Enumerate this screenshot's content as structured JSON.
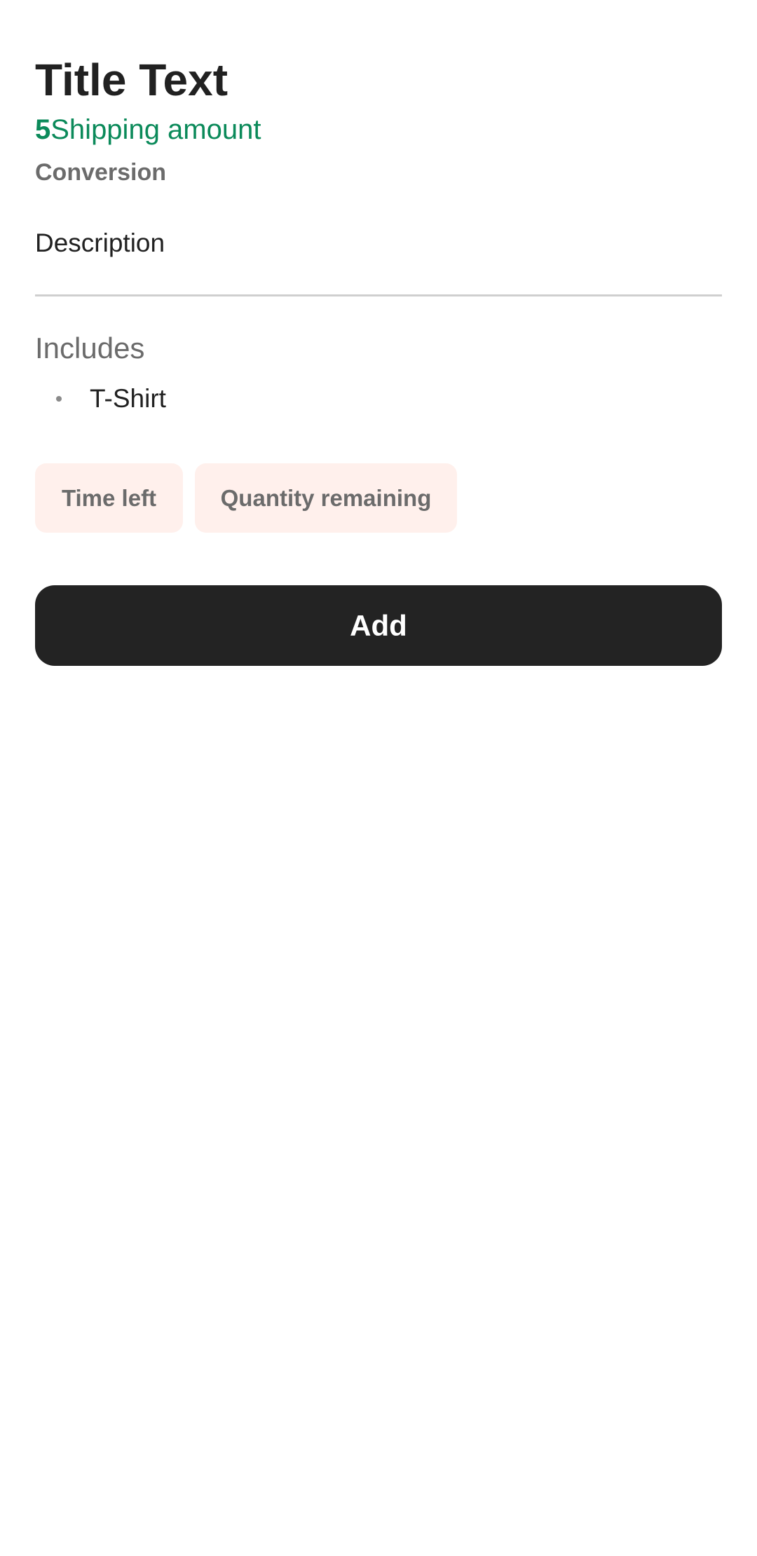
{
  "product": {
    "title": "Title Text",
    "price_value": "5",
    "price_label": "Shipping amount",
    "conversion": "Conversion",
    "description": "Description"
  },
  "includes": {
    "heading": "Includes",
    "items": [
      {
        "label": "T-Shirt"
      }
    ]
  },
  "chips": {
    "time_left": "Time left",
    "quantity_remaining": "Quantity remaining"
  },
  "actions": {
    "add_label": "Add"
  },
  "colors": {
    "accent_green": "#0b8a5a",
    "chip_background": "#fff0ec",
    "button_background": "#232323"
  }
}
